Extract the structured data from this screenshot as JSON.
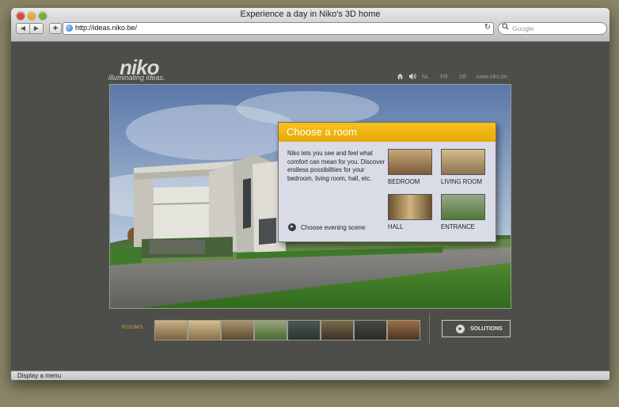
{
  "window": {
    "title": "Experience a day in Niko's 3D home"
  },
  "toolbar": {
    "back_icon": "◀",
    "forward_icon": "▶",
    "add_icon": "+",
    "url": "http://ideas.niko.be/",
    "reload_icon": "↻",
    "search_placeholder": "Google"
  },
  "brand": {
    "logo": "niko",
    "tagline": "illuminating ideas."
  },
  "topnav": {
    "home_icon": "⌂",
    "sound_icon": "🔊",
    "languages": [
      "NL",
      "FR",
      "DE"
    ],
    "separator": "-",
    "site": "www.niko.be"
  },
  "panel": {
    "title": "Choose a room",
    "description": "Niko lets you see and feel what comfort can mean for you. Discover endless possibilities for your bedroom, living room, hall, etc.",
    "evening_label": "Choose evening scene",
    "rooms": [
      {
        "label": "BEDROOM",
        "color": "#a08259"
      },
      {
        "label": "LIVING ROOM",
        "color": "#b09a70"
      },
      {
        "label": "HALL",
        "color": "#9a8458"
      },
      {
        "label": "ENTRANCE",
        "color": "#6f8a5a"
      }
    ]
  },
  "bottom": {
    "rooms_label": "ROOMS",
    "thumbnail_colors": [
      "#a68c66",
      "#b59d72",
      "#8b7a5c",
      "#6c7e54",
      "#3e4a40",
      "#5b5140",
      "#3b3a34",
      "#6a5238"
    ],
    "solutions_label": "SOLUTIONS"
  },
  "status": {
    "text": "Display a menu"
  },
  "colors": {
    "accent": "#f2b718",
    "background": "#4d4d49"
  }
}
